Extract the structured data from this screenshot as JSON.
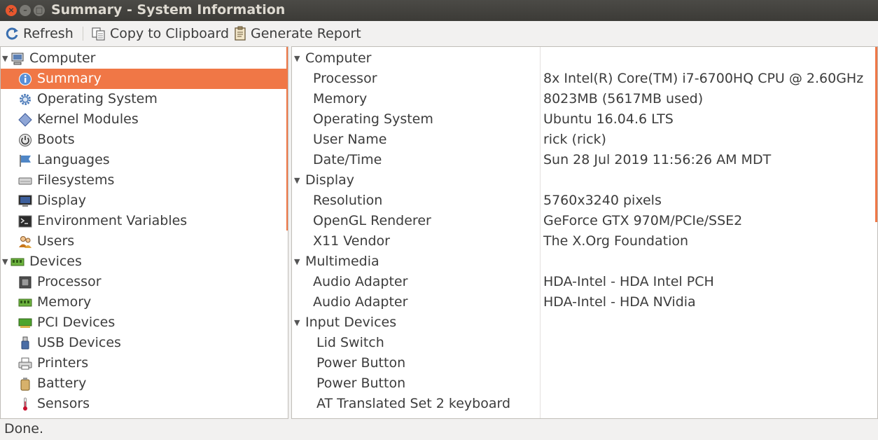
{
  "window": {
    "title": "Summary - System Information",
    "close": "×",
    "minimize": "–",
    "maximize": "□"
  },
  "toolbar": {
    "refresh": "Refresh",
    "copy": "Copy to Clipboard",
    "report": "Generate Report"
  },
  "tree": [
    {
      "label": "Computer",
      "level": 0,
      "icon": "computer-icon",
      "expanded": true
    },
    {
      "label": "Summary",
      "level": 1,
      "icon": "info-icon",
      "selected": true
    },
    {
      "label": "Operating System",
      "level": 1,
      "icon": "gear-icon"
    },
    {
      "label": "Kernel Modules",
      "level": 1,
      "icon": "diamond-icon"
    },
    {
      "label": "Boots",
      "level": 1,
      "icon": "power-icon"
    },
    {
      "label": "Languages",
      "level": 1,
      "icon": "flag-icon"
    },
    {
      "label": "Filesystems",
      "level": 1,
      "icon": "drive-icon"
    },
    {
      "label": "Display",
      "level": 1,
      "icon": "monitor-icon"
    },
    {
      "label": "Environment Variables",
      "level": 1,
      "icon": "terminal-icon"
    },
    {
      "label": "Users",
      "level": 1,
      "icon": "users-icon"
    },
    {
      "label": "Devices",
      "level": 0,
      "icon": "ram-icon",
      "expanded": true
    },
    {
      "label": "Processor",
      "level": 1,
      "icon": "cpu-icon"
    },
    {
      "label": "Memory",
      "level": 1,
      "icon": "ram-icon"
    },
    {
      "label": "PCI Devices",
      "level": 1,
      "icon": "pci-icon"
    },
    {
      "label": "USB Devices",
      "level": 1,
      "icon": "usb-icon"
    },
    {
      "label": "Printers",
      "level": 1,
      "icon": "printer-icon"
    },
    {
      "label": "Battery",
      "level": 1,
      "icon": "battery-icon"
    },
    {
      "label": "Sensors",
      "level": 1,
      "icon": "thermometer-icon"
    }
  ],
  "details": [
    {
      "type": "section",
      "label": "Computer"
    },
    {
      "type": "item",
      "label": "Processor",
      "value": "8x Intel(R) Core(TM) i7-6700HQ CPU @ 2.60GHz"
    },
    {
      "type": "item",
      "label": "Memory",
      "value": "8023MB (5617MB used)"
    },
    {
      "type": "item",
      "label": "Operating System",
      "value": "Ubuntu 16.04.6 LTS"
    },
    {
      "type": "item",
      "label": "User Name",
      "value": "rick (rick)"
    },
    {
      "type": "item",
      "label": "Date/Time",
      "value": "Sun 28 Jul 2019 11:56:26 AM MDT"
    },
    {
      "type": "section",
      "label": "Display"
    },
    {
      "type": "item",
      "label": "Resolution",
      "value": "5760x3240 pixels"
    },
    {
      "type": "item",
      "label": "OpenGL Renderer",
      "value": "GeForce GTX 970M/PCIe/SSE2"
    },
    {
      "type": "item",
      "label": "X11 Vendor",
      "value": "The X.Org Foundation"
    },
    {
      "type": "section",
      "label": "Multimedia"
    },
    {
      "type": "item",
      "label": "Audio Adapter",
      "value": "HDA-Intel - HDA Intel PCH"
    },
    {
      "type": "item",
      "label": "Audio Adapter",
      "value": "HDA-Intel - HDA NVidia"
    },
    {
      "type": "section",
      "label": "Input Devices"
    },
    {
      "type": "subitem",
      "label": "Lid Switch",
      "value": ""
    },
    {
      "type": "subitem",
      "label": "Power Button",
      "value": ""
    },
    {
      "type": "subitem",
      "label": "Power Button",
      "value": ""
    },
    {
      "type": "subitem",
      "label": "AT Translated Set 2 keyboard",
      "value": ""
    }
  ],
  "status": "Done.",
  "colors": {
    "accent": "#f07746",
    "titlebar": "#3c3b37"
  }
}
